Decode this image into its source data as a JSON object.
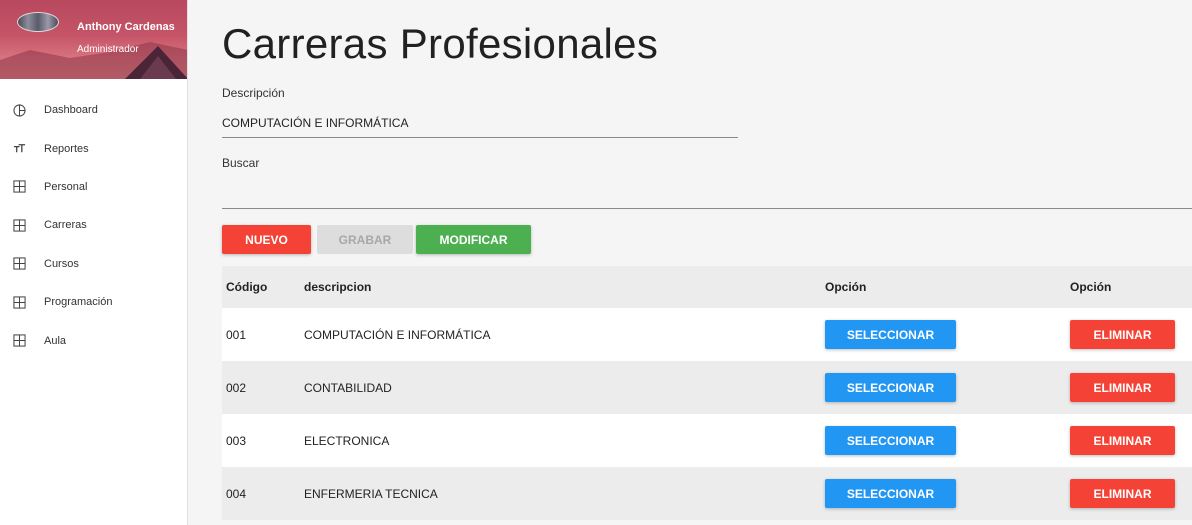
{
  "profile": {
    "name": "Anthony Cardenas",
    "role": "Administrador"
  },
  "nav": [
    {
      "label": "Dashboard",
      "icon": "pie-chart-icon"
    },
    {
      "label": "Reportes",
      "icon": "text-format-icon"
    },
    {
      "label": "Personal",
      "icon": "grid-table-icon"
    },
    {
      "label": "Carreras",
      "icon": "grid-table-icon"
    },
    {
      "label": "Cursos",
      "icon": "grid-table-icon"
    },
    {
      "label": "Programación",
      "icon": "grid-table-icon"
    },
    {
      "label": "Aula",
      "icon": "grid-table-icon"
    }
  ],
  "page": {
    "title": "Carreras Profesionales"
  },
  "form": {
    "descripcion_label": "Descripción",
    "descripcion_value": "COMPUTACIÓN E INFORMÁTICA",
    "buscar_label": "Buscar",
    "buscar_value": ""
  },
  "actions": {
    "nuevo": "NUEVO",
    "grabar": "GRABAR",
    "modificar": "MODIFICAR"
  },
  "table": {
    "headers": [
      "Código",
      "descripcion",
      "Opción",
      "Opción"
    ],
    "select_label": "SELECCIONAR",
    "delete_label": "ELIMINAR",
    "rows": [
      {
        "codigo": "001",
        "descripcion": "COMPUTACIÓN E INFORMÁTICA"
      },
      {
        "codigo": "002",
        "descripcion": "CONTABILIDAD"
      },
      {
        "codigo": "003",
        "descripcion": "ELECTRONICA"
      },
      {
        "codigo": "004",
        "descripcion": "ENFERMERIA TECNICA"
      }
    ]
  },
  "colors": {
    "danger": "#f44336",
    "primary": "#2196f3",
    "success": "#4caf50",
    "disabled": "#dddddd"
  }
}
